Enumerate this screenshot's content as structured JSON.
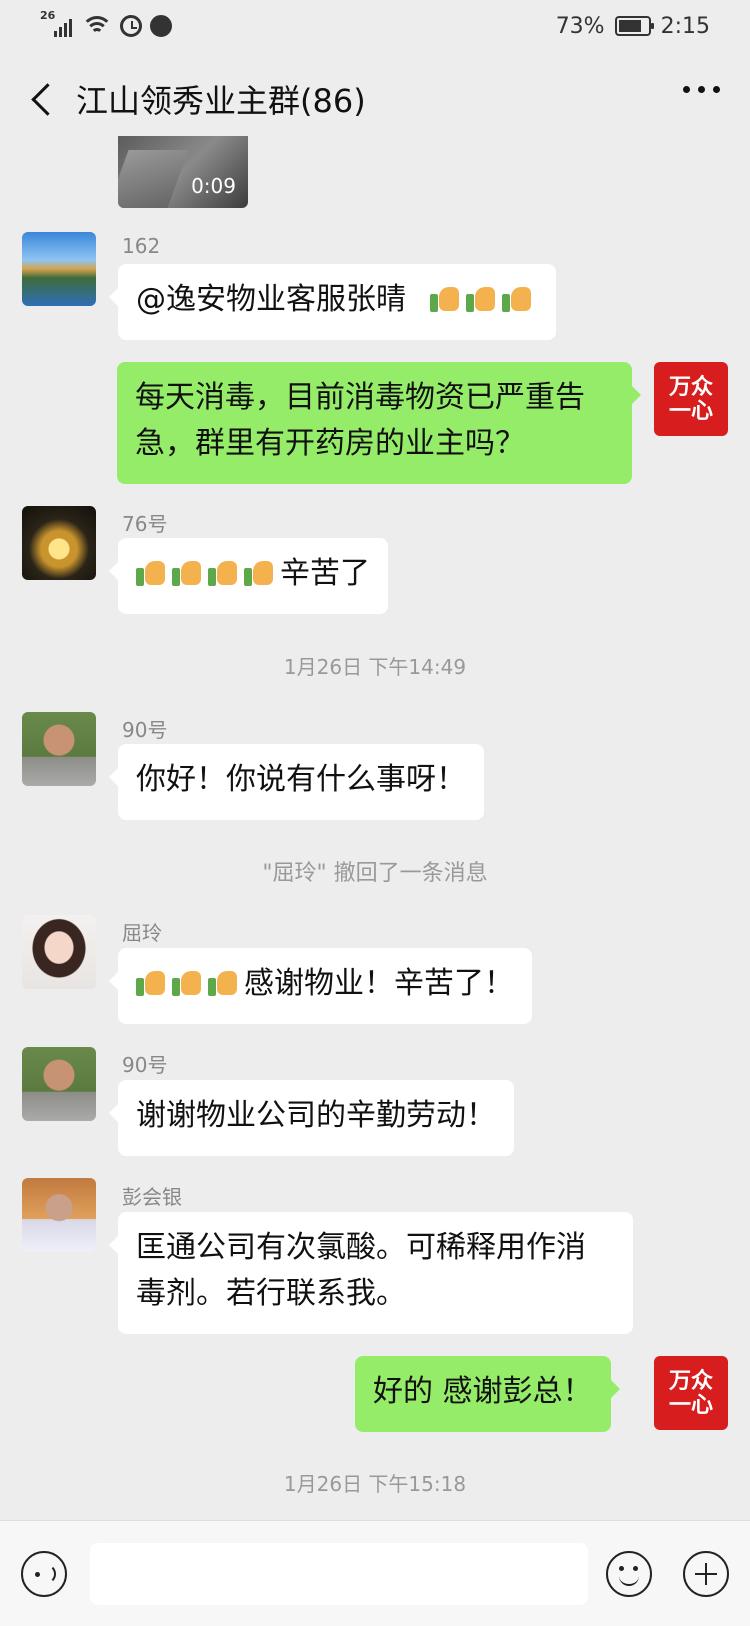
{
  "status_bar": {
    "network": "26",
    "battery": "73%",
    "time": "2:15"
  },
  "header": {
    "title": "江山领秀业主群(86)"
  },
  "video": {
    "duration": "0:09"
  },
  "messages": [
    {
      "sender": "162",
      "text": "@逸安物业客服张晴",
      "thumbs": 3
    },
    {
      "sender": "",
      "text_line1": "每天消毒，目前消毒物资已严重告",
      "text_line2": "急，群里有开药房的业主吗？"
    },
    {
      "sender": "76号",
      "text": "辛苦了",
      "thumbs": 4
    },
    {
      "sender": "90号",
      "text": "你好！你说有什么事呀！"
    },
    {
      "sender": "屈玲",
      "text": "感谢物业！辛苦了！",
      "thumbs": 3
    },
    {
      "sender": "90号",
      "text": "谢谢物业公司的辛勤劳动！"
    },
    {
      "sender": "彭会银",
      "text_line1": "匡通公司有次氯酸。可稀释用作消",
      "text_line2": "毒剂。若行联系我。"
    },
    {
      "sender": "",
      "text": "好的 感谢彭总！"
    }
  ],
  "timestamps": [
    "1月26日 下午14:49",
    "1月26日 下午15:18"
  ],
  "system_notice": "\"屈玲\" 撤回了一条消息",
  "self_avatar": {
    "line1": "万众",
    "line2": "一心"
  },
  "colors": {
    "background": "#ededed",
    "self_bubble": "#95ec69",
    "other_bubble": "#ffffff",
    "self_avatar": "#d71d1d"
  }
}
